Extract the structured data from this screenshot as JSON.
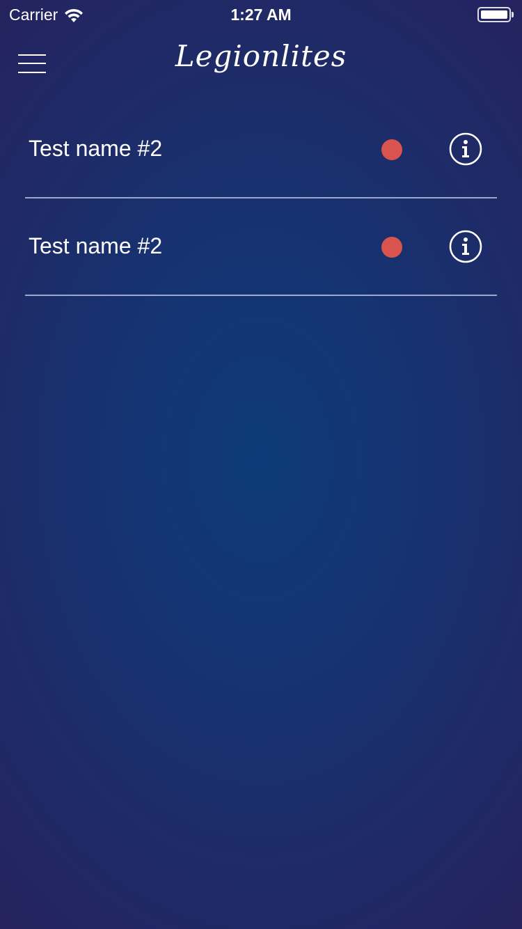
{
  "status_bar": {
    "carrier": "Carrier",
    "time": "1:27 AM"
  },
  "header": {
    "title": "Legionlites",
    "menu_icon": "hamburger-menu-icon"
  },
  "items": [
    {
      "name": "Test name #2",
      "status_color": "#d9534f",
      "info_icon": "info-circle-icon"
    },
    {
      "name": "Test name #2",
      "status_color": "#d9534f",
      "info_icon": "info-circle-icon"
    }
  ],
  "colors": {
    "background_center": "#0d3a78",
    "background_edge": "#26215e",
    "status_dot": "#d9534f",
    "divider": "#c8d2eb"
  }
}
